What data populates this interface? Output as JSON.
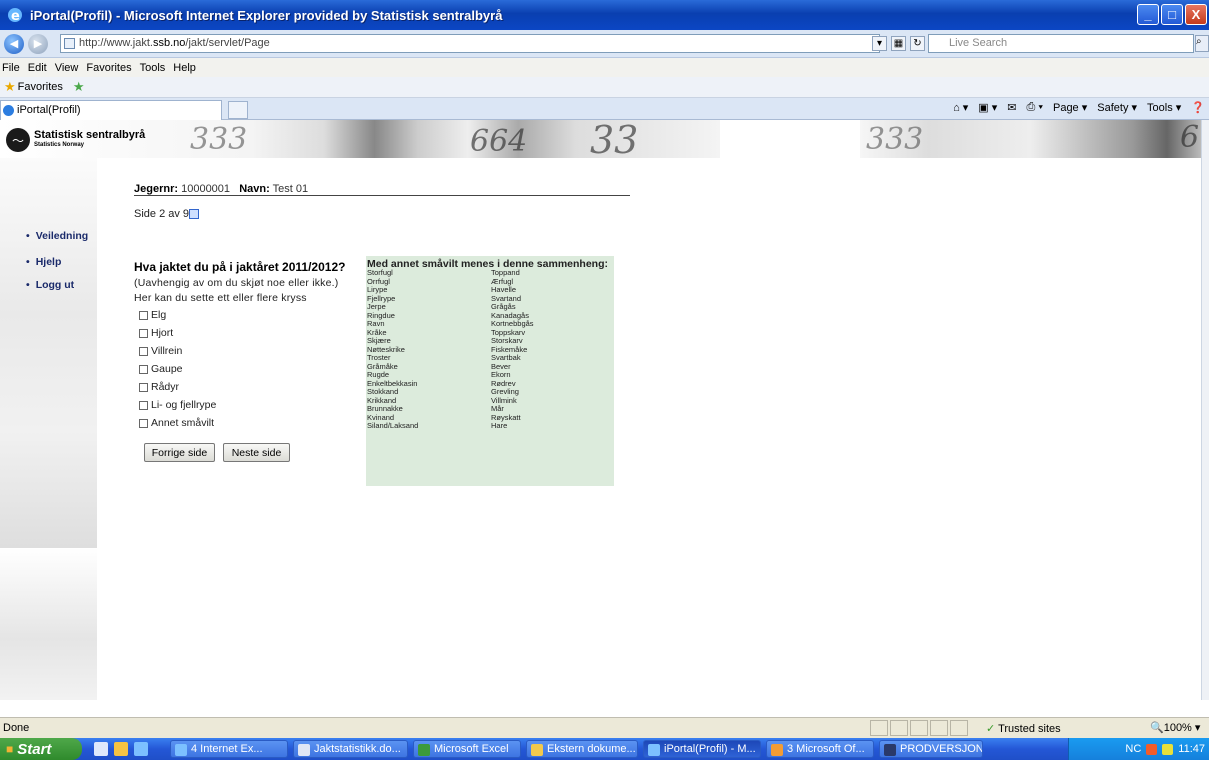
{
  "window": {
    "title": "iPortal(Profil) - Microsoft Internet Explorer provided by Statistisk sentralbyrå",
    "min": "_",
    "max": "□",
    "close": "X"
  },
  "address": {
    "url_prefix": "http://www.jakt.",
    "url_domain": "ssb.no",
    "url_suffix": "/jakt/servlet/Page",
    "search_placeholder": "Live Search"
  },
  "menu": [
    "File",
    "Edit",
    "View",
    "Favorites",
    "Tools",
    "Help"
  ],
  "favorites_label": "Favorites",
  "tab": {
    "label": "iPortal(Profil)"
  },
  "commands": [
    "Page ▾",
    "Safety ▾",
    "Tools ▾"
  ],
  "logo": {
    "name": "Statistisk sentralbyrå",
    "sub": "Statistics Norway"
  },
  "banner_numbers": [
    "333",
    "664",
    "33",
    "333",
    "6"
  ],
  "nav": [
    "Veiledning",
    "Hjelp",
    "Logg ut"
  ],
  "header": {
    "jegernr_label": "Jegernr:",
    "jegernr": "10000001",
    "navn_label": "Navn:",
    "navn": "Test 01"
  },
  "page_indicator": "Side 2 av 9",
  "question": {
    "title": "Hva jaktet du på i jaktåret 2011/2012?",
    "line1": "(Uavhengig av om du skjøt noe eller ikke.)",
    "line2": "Her kan du sette ett eller flere kryss",
    "options": [
      "Elg",
      "Hjort",
      "Villrein",
      "Gaupe",
      "Rådyr",
      "Li- og fjellrype",
      "Annet småvilt"
    ]
  },
  "buttons": {
    "prev": "Forrige side",
    "next": "Neste side"
  },
  "info": {
    "heading": "Med annet småvilt menes i denne sammenheng:",
    "col1": [
      "Storfugl",
      "Orrfugl",
      "Lirype",
      "Fjellrype",
      "Jerpe",
      "Ringdue",
      "Ravn",
      "Kråke",
      "Skjære",
      "Nøtteskrike",
      "Troster",
      "Gråmåke",
      "Rugde",
      "Enkeltbekkasin",
      "Stokkand",
      "Krikkand",
      "Brunnakke",
      "Kvinand",
      "Siland/Laksand"
    ],
    "col2": [
      "Toppand",
      "Ærfugl",
      "Havelle",
      "Svartand",
      "Grågås",
      "Kanadagås",
      "Kortnebbgås",
      "Toppskarv",
      "Storskarv",
      "Fiskemåke",
      "Svartbak",
      "Bever",
      "Ekorn",
      "Rødrev",
      "Grevling",
      "Villmink",
      "Mår",
      "Røyskatt",
      "Hare"
    ]
  },
  "status": {
    "left": "Done",
    "zone": "Trusted sites",
    "zoom": "100%"
  },
  "taskbar": {
    "start": "Start",
    "items": [
      "4 Internet Ex...",
      "Jaktstatistikk.do...",
      "Microsoft Excel",
      "Ekstern dokume...",
      "iPortal(Profil) - M...",
      "3 Microsoft Of...",
      "PRODVERSJON ..."
    ],
    "tray_text": "NC",
    "clock": "11:47"
  }
}
